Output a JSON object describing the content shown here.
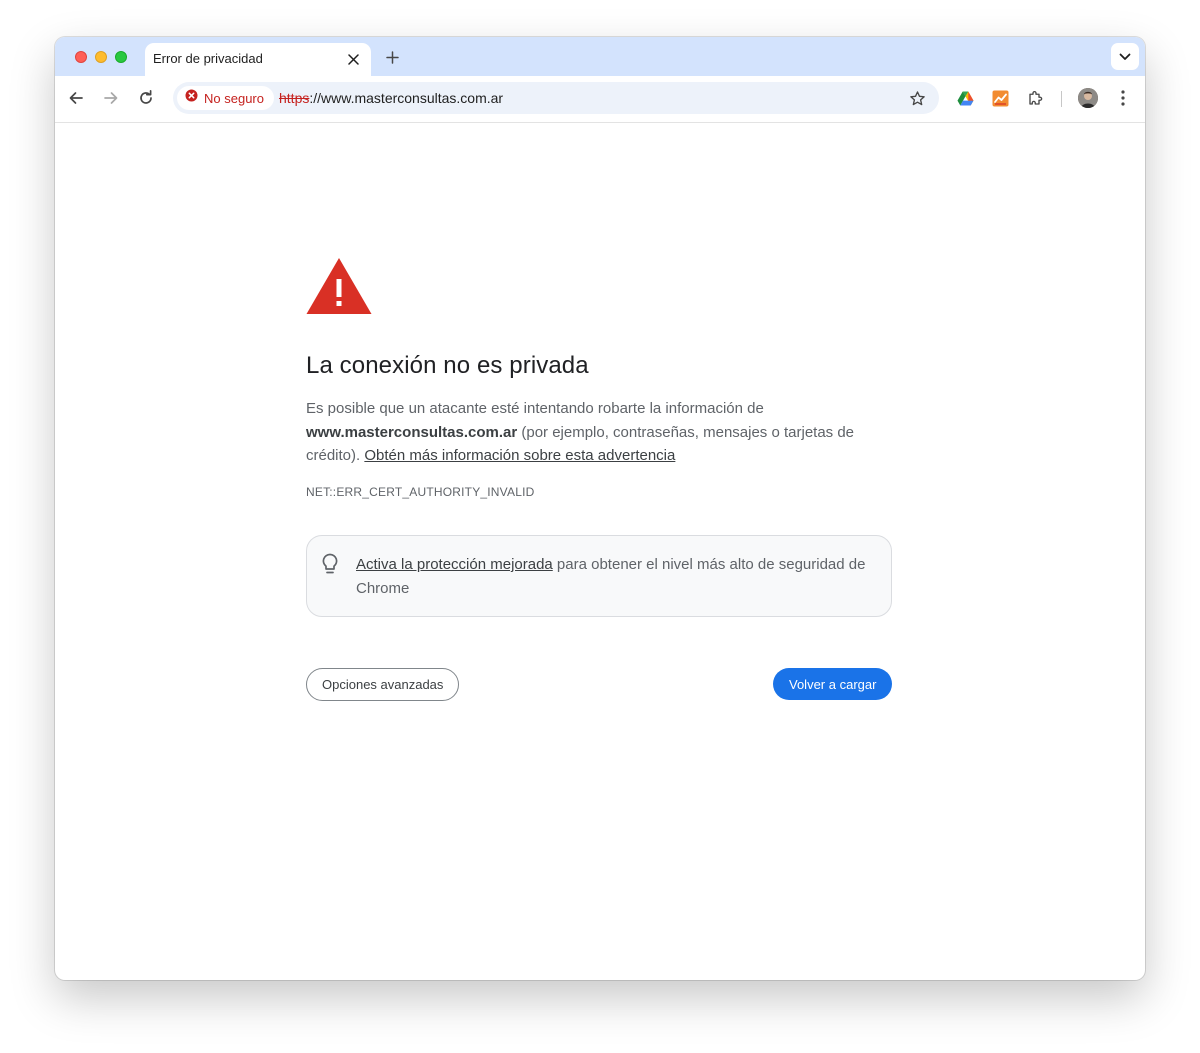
{
  "browser": {
    "tab": {
      "title": "Error de privacidad"
    },
    "omnibox": {
      "security_chip": "No seguro",
      "url_scheme": "https",
      "url_rest": "://www.masterconsultas.com.ar"
    },
    "colors": {
      "tabstrip": "#d3e3fd",
      "omnibox": "#edf2fa",
      "insecure_red": "#c5221f"
    }
  },
  "interstitial": {
    "heading": "La conexión no es privada",
    "desc_part1": "Es posible que un atacante esté intentando robarte la información de ",
    "domain": "www.masterconsultas.com.ar",
    "desc_part2": " (por ejemplo, contraseñas, mensajes o tarjetas de crédito). ",
    "learn_more_link": "Obtén más información sobre esta advertencia",
    "error_code": "NET::ERR_CERT_AUTHORITY_INVALID",
    "callout": {
      "link": "Activa la protección mejorada",
      "text": " para obtener el nivel más alto de seguridad de Chrome"
    },
    "advanced_button": "Opciones avanzadas",
    "reload_button": "Volver a cargar",
    "colors": {
      "warning_red": "#d93025",
      "primary_blue": "#1a73e8"
    }
  },
  "icons": [
    "close-window-icon",
    "minimize-window-icon",
    "zoom-window-icon",
    "close-tab-icon",
    "new-tab-icon",
    "tab-search-chevron-icon",
    "back-arrow-icon",
    "forward-arrow-icon",
    "reload-icon",
    "not-secure-icon",
    "bookmark-star-icon",
    "google-drive-icon",
    "extension-app-icon",
    "puzzle-extensions-icon",
    "profile-avatar",
    "kebab-menu-icon",
    "warning-triangle-icon",
    "lightbulb-icon"
  ]
}
